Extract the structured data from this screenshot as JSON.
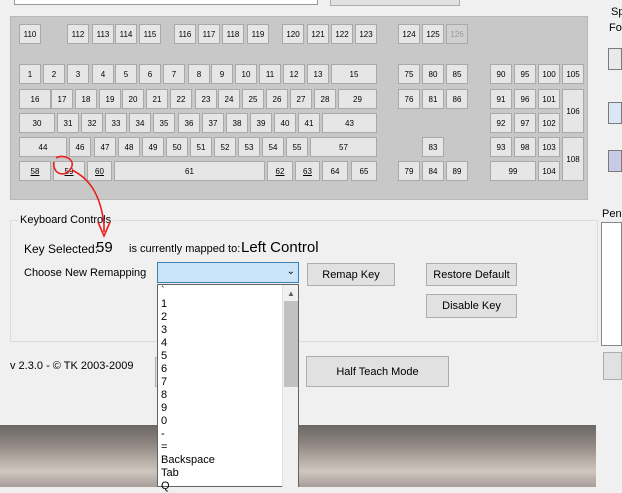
{
  "keyboard": {
    "function_row": [
      "110",
      "112",
      "113",
      "114",
      "115",
      "116",
      "117",
      "118",
      "119",
      "120",
      "121",
      "122",
      "123",
      "124",
      "125",
      "126"
    ],
    "row1": [
      "1",
      "2",
      "3",
      "4",
      "5",
      "6",
      "7",
      "8",
      "9",
      "10",
      "11",
      "12",
      "13",
      "15"
    ],
    "row2": [
      "16",
      "17",
      "18",
      "19",
      "20",
      "21",
      "22",
      "23",
      "24",
      "25",
      "26",
      "27",
      "28",
      "29"
    ],
    "row3": [
      "30",
      "31",
      "32",
      "33",
      "34",
      "35",
      "36",
      "37",
      "38",
      "39",
      "40",
      "41",
      "43"
    ],
    "row4": [
      "44",
      "46",
      "47",
      "48",
      "49",
      "50",
      "51",
      "52",
      "53",
      "54",
      "55",
      "57"
    ],
    "row5": [
      "58",
      "59",
      "60",
      "61",
      "62",
      "63",
      "64",
      "65"
    ],
    "nav_top": [
      "75",
      "80",
      "85",
      "76",
      "81",
      "86"
    ],
    "nav_bottom": [
      "83",
      "79",
      "84",
      "89"
    ],
    "numpad": [
      "90",
      "95",
      "100",
      "105",
      "91",
      "96",
      "101",
      "106",
      "92",
      "97",
      "102",
      "93",
      "98",
      "103",
      "108",
      "99",
      "104"
    ]
  },
  "controls": {
    "group_title": "Keyboard Controls",
    "key_selected_label": "Key Selected:",
    "key_selected_value": "59",
    "mapped_label": "is currently mapped to:",
    "mapped_value": "Left Control",
    "choose_label": "Choose New Remapping",
    "remap_button": "Remap Key",
    "restore_button": "Restore Default",
    "disable_button": "Disable Key",
    "half_teach_button": "Half Teach Mode",
    "version": "v 2.3.0 - © TK 2003-2009"
  },
  "dropdown": {
    "items": [
      "`",
      "1",
      "2",
      "3",
      "4",
      "5",
      "6",
      "7",
      "8",
      "9",
      "0",
      "-",
      "=",
      "Backspace",
      "Tab",
      "Q"
    ]
  },
  "side": {
    "sp_label": "Sp",
    "fo_label": "Fo",
    "pen_label": "Pen"
  },
  "annotation_color": "#e8201c"
}
